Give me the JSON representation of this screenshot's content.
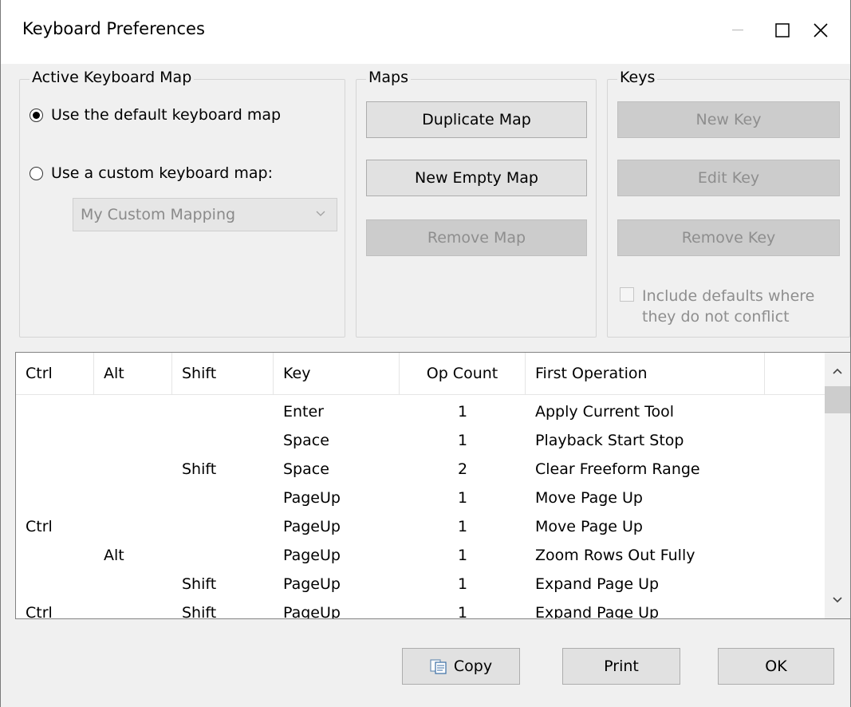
{
  "window": {
    "title": "Keyboard Preferences"
  },
  "active_map": {
    "legend": "Active Keyboard Map",
    "default_label": "Use the default keyboard map",
    "custom_label": "Use a custom keyboard map:",
    "custom_select_value": "My Custom Mapping",
    "selected": "default"
  },
  "maps": {
    "legend": "Maps",
    "duplicate": "Duplicate Map",
    "new_empty": "New Empty Map",
    "remove": "Remove Map"
  },
  "keys": {
    "legend": "Keys",
    "new_key": "New Key",
    "edit_key": "Edit Key",
    "remove_key": "Remove Key",
    "include_defaults_line1": "Include defaults where",
    "include_defaults_line2": "they do not conflict"
  },
  "table": {
    "columns": [
      "Ctrl",
      "Alt",
      "Shift",
      "Key",
      "Op Count",
      "First Operation"
    ],
    "rows": [
      [
        "",
        "",
        "",
        "Enter",
        "1",
        "Apply Current Tool"
      ],
      [
        "",
        "",
        "",
        "Space",
        "1",
        "Playback Start Stop"
      ],
      [
        "",
        "",
        "Shift",
        "Space",
        "2",
        "Clear Freeform Range"
      ],
      [
        "",
        "",
        "",
        "PageUp",
        "1",
        "Move Page Up"
      ],
      [
        "Ctrl",
        "",
        "",
        "PageUp",
        "1",
        "Move Page Up"
      ],
      [
        "",
        "Alt",
        "",
        "PageUp",
        "1",
        "Zoom Rows Out Fully"
      ],
      [
        "",
        "",
        "Shift",
        "PageUp",
        "1",
        "Expand Page Up"
      ],
      [
        "Ctrl",
        "",
        "Shift",
        "PageUp",
        "1",
        "Expand Page Up"
      ]
    ]
  },
  "footer": {
    "copy": "Copy",
    "print": "Print",
    "ok": "OK"
  }
}
